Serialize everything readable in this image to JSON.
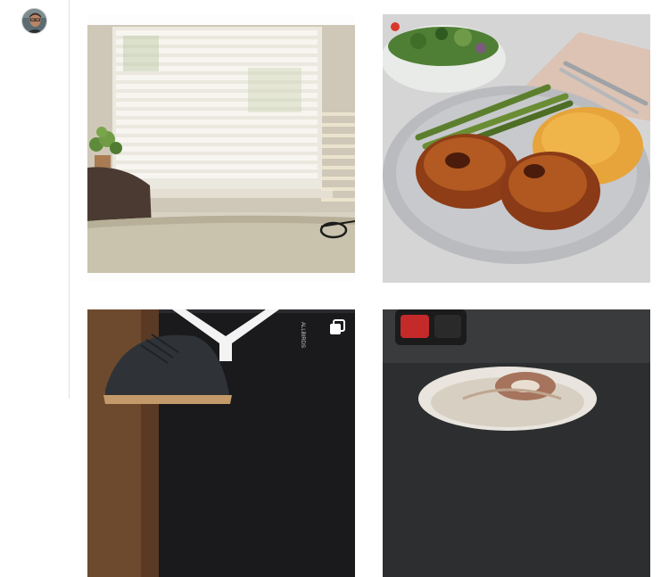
{
  "sidebar": {
    "avatar_icon": "user-profile-avatar-icon"
  },
  "feed": {
    "posts": [
      {
        "icon": "photo-window-blinds-icon",
        "multiple": false
      },
      {
        "icon": "photo-chicken-dinner-icon",
        "multiple": false
      },
      {
        "icon": "photo-shoe-on-box-icon",
        "multiple": true,
        "badge_icon": "multiple-photos-icon"
      },
      {
        "icon": "photo-latte-cup-icon",
        "multiple": false
      }
    ]
  },
  "colors": {
    "sidebar_border": "#e2e2e2",
    "page_background": "#ffffff",
    "badge": "#ffffff"
  }
}
